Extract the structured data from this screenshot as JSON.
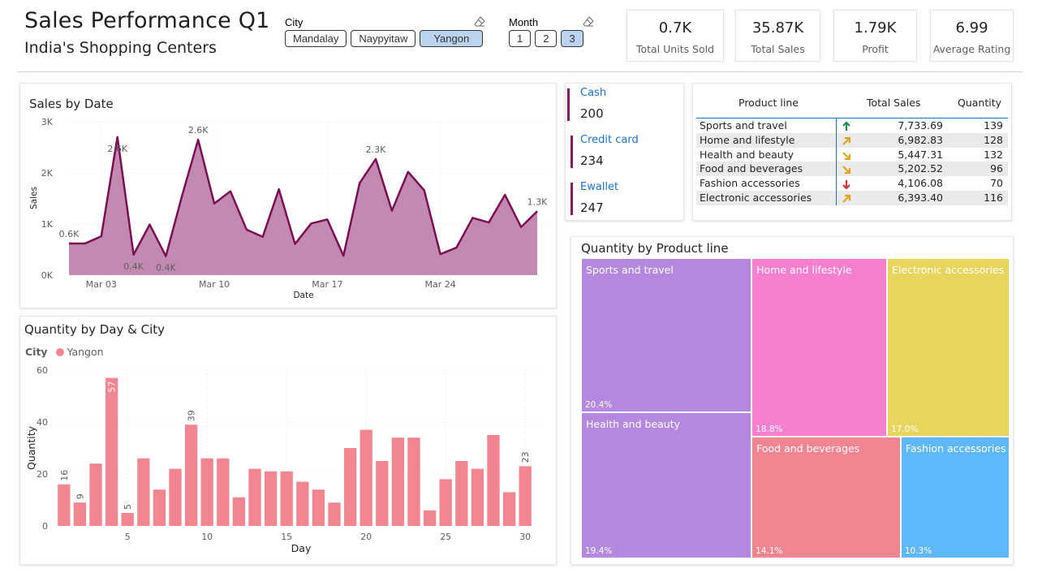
{
  "header": {
    "title": "Sales Performance Q1",
    "subtitle": "India's Shopping Centers"
  },
  "city_slicer": {
    "label": "City",
    "options": [
      "Mandalay",
      "Naypyitaw",
      "Yangon"
    ],
    "selected": "Yangon"
  },
  "month_slicer": {
    "label": "Month",
    "options": [
      "1",
      "2",
      "3"
    ],
    "selected": "3"
  },
  "kpis": [
    {
      "value": "0.7K",
      "label": "Total Units Sold"
    },
    {
      "value": "35.87K",
      "label": "Total Sales"
    },
    {
      "value": "1.79K",
      "label": "Profit"
    },
    {
      "value": "6.99",
      "label": "Average Rating"
    }
  ],
  "payments": [
    {
      "label": "Cash",
      "value": "200"
    },
    {
      "label": "Credit card",
      "value": "234"
    },
    {
      "label": "Ewallet",
      "value": "247"
    }
  ],
  "product_table": {
    "headers": [
      "Product line",
      "Total Sales",
      "Quantity"
    ],
    "rows": [
      {
        "product": "Sports and travel",
        "trend_icon": "arrow-up-icon",
        "trend_color": "#1e8a4c",
        "sales": "7,733.69",
        "qty": "139"
      },
      {
        "product": "Home and lifestyle",
        "trend_icon": "arrow-up-right-icon",
        "trend_color": "#e3a21a",
        "sales": "6,982.83",
        "qty": "128"
      },
      {
        "product": "Health and beauty",
        "trend_icon": "arrow-down-right-icon",
        "trend_color": "#e3a21a",
        "sales": "5,447.31",
        "qty": "132"
      },
      {
        "product": "Food and beverages",
        "trend_icon": "arrow-down-right-icon",
        "trend_color": "#e3a21a",
        "sales": "5,202.52",
        "qty": "96"
      },
      {
        "product": "Fashion accessories",
        "trend_icon": "arrow-down-icon",
        "trend_color": "#d13438",
        "sales": "4,106.08",
        "qty": "70"
      },
      {
        "product": "Electronic accessories",
        "trend_icon": "arrow-up-right-icon",
        "trend_color": "#e3a21a",
        "sales": "6,393.40",
        "qty": "116"
      }
    ]
  },
  "chart_data": [
    {
      "type": "area",
      "title": "Sales by Date",
      "xlabel": "Date",
      "ylabel": "Sales",
      "ylim": [
        0,
        3000
      ],
      "yticks": [
        "0K",
        "1K",
        "2K",
        "3K"
      ],
      "xticks": [
        "Mar 03",
        "Mar 10",
        "Mar 17",
        "Mar 24"
      ],
      "xtick_days": [
        3,
        10,
        17,
        24
      ],
      "color": "#7b0f55",
      "fill": "#c28ab1",
      "grid": true,
      "x": [
        1,
        2,
        3,
        4,
        5,
        6,
        7,
        8,
        9,
        10,
        11,
        12,
        13,
        14,
        15,
        16,
        17,
        18,
        19,
        20,
        21,
        22,
        23,
        24,
        25,
        26,
        27,
        28,
        29,
        30
      ],
      "values": [
        620,
        620,
        760,
        2700,
        400,
        990,
        370,
        1550,
        2650,
        1400,
        1640,
        890,
        750,
        1680,
        610,
        1010,
        1090,
        380,
        1800,
        2270,
        1260,
        2020,
        1660,
        410,
        540,
        1120,
        1030,
        1570,
        940,
        1250
      ],
      "data_labels": [
        {
          "day": 1,
          "text": "0.6K",
          "pos": "above"
        },
        {
          "day": 4,
          "text": "2.6K",
          "pos": "left"
        },
        {
          "day": 5,
          "text": "0.4K",
          "pos": "below"
        },
        {
          "day": 7,
          "text": "0.4K",
          "pos": "below"
        },
        {
          "day": 9,
          "text": "2.6K",
          "pos": "above"
        },
        {
          "day": 20,
          "text": "2.3K",
          "pos": "above"
        },
        {
          "day": 30,
          "text": "1.3K",
          "pos": "above"
        }
      ]
    },
    {
      "type": "bar",
      "title": "Quantity by Day & City",
      "xlabel": "Day",
      "ylabel": "Quantity",
      "legend_title": "City",
      "legend": [
        {
          "name": "Yangon",
          "color": "#f28592"
        }
      ],
      "ylim": [
        0,
        60
      ],
      "yticks": [
        0,
        20,
        40,
        60
      ],
      "xticks": [
        5,
        10,
        15,
        20,
        25,
        30
      ],
      "grid": true,
      "color": "#f28592",
      "categories": [
        1,
        2,
        3,
        4,
        5,
        6,
        7,
        8,
        9,
        10,
        11,
        12,
        13,
        14,
        15,
        16,
        17,
        18,
        19,
        20,
        21,
        22,
        23,
        24,
        25,
        26,
        27,
        28,
        29,
        30
      ],
      "values": [
        16,
        9,
        24,
        57,
        5,
        26,
        14,
        22,
        39,
        26,
        26,
        11,
        22,
        21,
        21,
        17,
        14,
        9,
        30,
        37,
        25,
        34,
        34,
        6,
        18,
        25,
        22,
        35,
        13,
        23
      ],
      "labeled_days": [
        1,
        2,
        4,
        5,
        9,
        30
      ]
    },
    {
      "type": "treemap",
      "title": "Quantity by Product line",
      "items": [
        {
          "name": "Sports and travel",
          "pct": "20.4%",
          "color": "#b388de"
        },
        {
          "name": "Health and beauty",
          "pct": "19.4%",
          "color": "#b388de"
        },
        {
          "name": "Home and lifestyle",
          "pct": "18.8%",
          "color": "#f77fcf"
        },
        {
          "name": "Food and beverages",
          "pct": "14.1%",
          "color": "#f28592"
        },
        {
          "name": "Electronic accessories",
          "pct": "17.0%",
          "color": "#e8d55e"
        },
        {
          "name": "Fashion accessories",
          "pct": "10.3%",
          "color": "#5fb8fc"
        }
      ]
    }
  ]
}
